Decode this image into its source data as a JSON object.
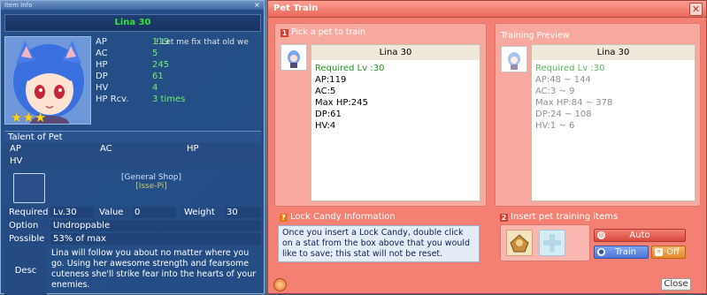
{
  "info": {
    "title_bar": "Item Info",
    "pet_name": "Lina 30",
    "stars": "★★★",
    "stats": [
      {
        "label": "AP",
        "value": "119"
      },
      {
        "label": "AC",
        "value": "5"
      },
      {
        "label": "HP",
        "value": "245"
      },
      {
        "label": "DP",
        "value": "61"
      },
      {
        "label": "HV",
        "value": "4"
      },
      {
        "label": "HP Rcv.",
        "value": "3 times"
      }
    ],
    "chat_text": "! Let me fix that old we",
    "talent_header": "Talent of Pet",
    "talent": {
      "ap": "AP",
      "ac": "AC",
      "hp": "HP",
      "hv": "HV"
    },
    "shop_name": "[General Shop]",
    "shop_sub": "[Isse-Pi]",
    "required_label": "Required",
    "required_value": "Lv.30",
    "value_label": "Value",
    "value_value": "0",
    "weight_label": "Weight",
    "weight_value": "30",
    "option_label": "Option",
    "option_value": "Undroppable",
    "possible_label": "Possible",
    "possible_value": "53% of max",
    "desc_label": "Desc",
    "desc_text": "Lina will follow you about no matter where you go. Using her awesome strength and fearsome cuteness she'll strike fear into the hearts of your enemies."
  },
  "pettrain": {
    "title": "Pet Train",
    "close_icon": "close-icon",
    "step1": {
      "num": "1",
      "label": "Pick a pet to train"
    },
    "pet_card": {
      "name": "Lina 30",
      "lines": [
        "Required Lv :30",
        "AP:119",
        "AC:5",
        "Max HP:245",
        "DP:61",
        "HV:4"
      ]
    },
    "preview": {
      "header": "Training Preview",
      "name": "Lina 30",
      "lines": [
        "Required Lv :30",
        "AP:48 ~ 144",
        "AC:3 ~ 9",
        "Max HP:84 ~ 378",
        "DP:24 ~ 108",
        "HV:1 ~ 6"
      ]
    },
    "step_lock": {
      "num": "?",
      "label": "Lock Candy Information"
    },
    "lock_text": "Once you insert a Lock Candy, double click on a stat from the box above that you would like to save; this stat will not be reset.",
    "step2": {
      "num": "2",
      "label": "Insert pet training items"
    },
    "buttons": {
      "auto": "Auto",
      "train": "Train",
      "off": "Off",
      "close": "Close"
    },
    "colors": {
      "window": "#f47f73",
      "panel": "#f7a89f",
      "auto": "#e05a4d",
      "train": "#5b82de",
      "off": "#ee9b3f"
    }
  }
}
